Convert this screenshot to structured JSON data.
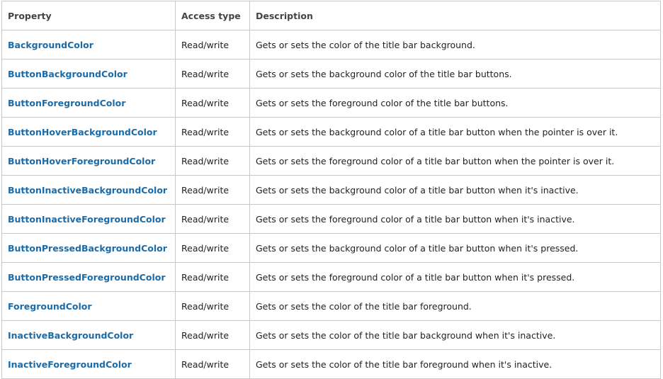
{
  "table": {
    "headers": [
      "Property",
      "Access type",
      "Description"
    ],
    "rows": [
      {
        "property": "BackgroundColor",
        "access": "Read/write",
        "description": "Gets or sets the color of the title bar background."
      },
      {
        "property": "ButtonBackgroundColor",
        "access": "Read/write",
        "description": "Gets or sets the background color of the title bar buttons."
      },
      {
        "property": "ButtonForegroundColor",
        "access": "Read/write",
        "description": "Gets or sets the foreground color of the title bar buttons."
      },
      {
        "property": "ButtonHoverBackgroundColor",
        "access": "Read/write",
        "description": "Gets or sets the background color of a title bar button when the pointer is over it."
      },
      {
        "property": "ButtonHoverForegroundColor",
        "access": "Read/write",
        "description": "Gets or sets the foreground color of a title bar button when the pointer is over it."
      },
      {
        "property": "ButtonInactiveBackgroundColor",
        "access": "Read/write",
        "description": "Gets or sets the background color of a title bar button when it's inactive."
      },
      {
        "property": "ButtonInactiveForegroundColor",
        "access": "Read/write",
        "description": "Gets or sets the foreground color of a title bar button when it's inactive."
      },
      {
        "property": "ButtonPressedBackgroundColor",
        "access": "Read/write",
        "description": "Gets or sets the background color of a title bar button when it's pressed."
      },
      {
        "property": "ButtonPressedForegroundColor",
        "access": "Read/write",
        "description": "Gets or sets the foreground color of a title bar button when it's pressed."
      },
      {
        "property": "ForegroundColor",
        "access": "Read/write",
        "description": "Gets or sets the color of the title bar foreground."
      },
      {
        "property": "InactiveBackgroundColor",
        "access": "Read/write",
        "description": "Gets or sets the color of the title bar background when it's inactive."
      },
      {
        "property": "InactiveForegroundColor",
        "access": "Read/write",
        "description": "Gets or sets the color of the title bar foreground when it's inactive."
      }
    ]
  },
  "colors": {
    "link": "#1a6ba8",
    "border": "#c8c8c8",
    "header_text": "#444444",
    "body_text": "#222222"
  }
}
